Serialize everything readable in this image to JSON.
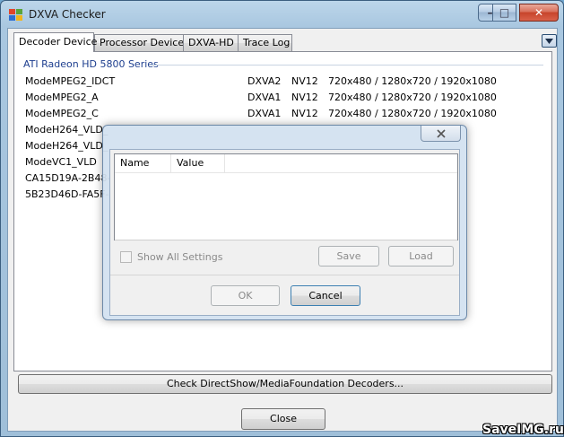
{
  "window": {
    "title": "DXVA Checker",
    "controls": {
      "minimize": "–",
      "maximize": "□",
      "close": "✕"
    }
  },
  "tabs": [
    {
      "label": "Decoder Device",
      "active": true
    },
    {
      "label": "Processor Device",
      "active": false
    },
    {
      "label": "DXVA-HD",
      "active": false
    },
    {
      "label": "Trace Log",
      "active": false
    }
  ],
  "group_title": "ATI Radeon HD 5800 Series",
  "decoders": [
    {
      "name": "ModeMPEG2_IDCT",
      "api": "DXVA2",
      "format": "NV12",
      "resolutions": "720x480 / 1280x720 / 1920x1080"
    },
    {
      "name": "ModeMPEG2_A",
      "api": "DXVA1",
      "format": "NV12",
      "resolutions": "720x480 / 1280x720 / 1920x1080"
    },
    {
      "name": "ModeMPEG2_C",
      "api": "DXVA1",
      "format": "NV12",
      "resolutions": "720x480 / 1280x720 / 1920x1080"
    },
    {
      "name": "ModeH264_VLD_",
      "api": "",
      "format": "",
      "resolutions": ""
    },
    {
      "name": "ModeH264_VLD_",
      "api": "",
      "format": "",
      "resolutions": ""
    },
    {
      "name": "ModeVC1_VLD",
      "api": "",
      "format": "",
      "resolutions": ""
    },
    {
      "name": "CA15D19A-2B48-4",
      "api": "",
      "format": "",
      "resolutions": ""
    },
    {
      "name": "5B23D46D-FA5F-4",
      "api": "",
      "format": "",
      "resolutions": ""
    }
  ],
  "bottom": {
    "check_button": "Check DirectShow/MediaFoundation Decoders...",
    "close_button": "Close"
  },
  "dialog": {
    "columns": [
      "Name",
      "Value"
    ],
    "show_all_label": "Show All Settings",
    "save_label": "Save",
    "load_label": "Load",
    "ok_label": "OK",
    "cancel_label": "Cancel"
  },
  "watermark": "SaveIMG.ru",
  "colors": {
    "group_title": "#1e3f8f",
    "close_button_red": "#c7442b"
  }
}
